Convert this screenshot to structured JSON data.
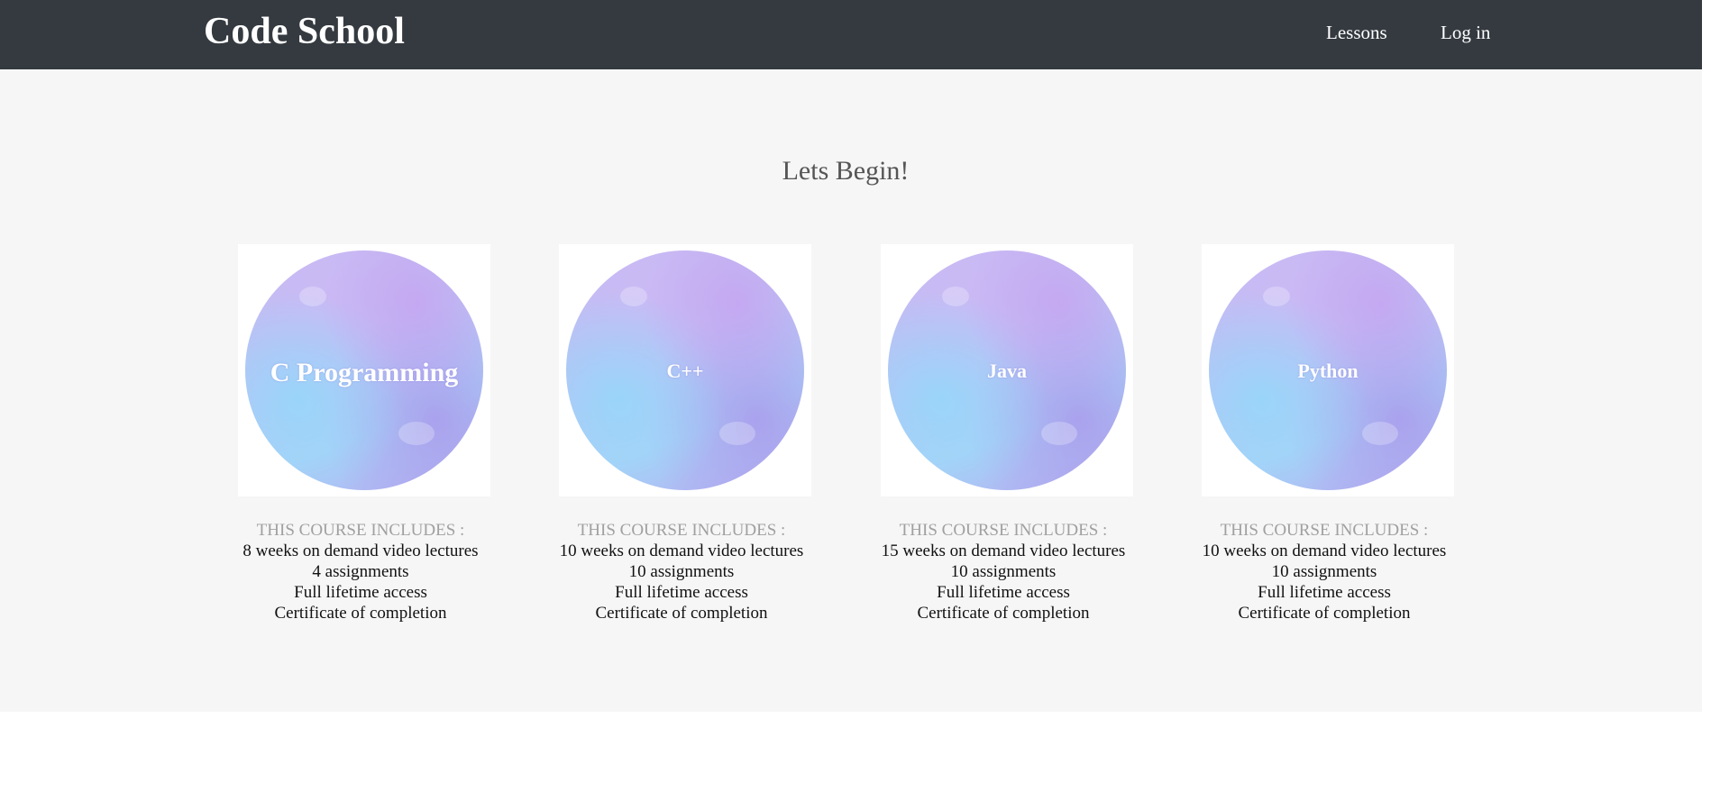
{
  "navbar": {
    "brand": "Code School",
    "links": [
      {
        "label": "Lessons"
      },
      {
        "label": "Log in"
      }
    ]
  },
  "main": {
    "title": "Lets Begin!",
    "courses": [
      {
        "name": "C Programming",
        "includes_label": "THIS COURSE INCLUDES :",
        "features": [
          "8 weeks on demand video lectures",
          "4 assignments",
          "Full lifetime access",
          "Certificate of completion"
        ]
      },
      {
        "name": "C++",
        "includes_label": "THIS COURSE INCLUDES :",
        "features": [
          "10 weeks on demand video lectures",
          "10 assignments",
          "Full lifetime access",
          "Certificate of completion"
        ]
      },
      {
        "name": "Java",
        "includes_label": "THIS COURSE INCLUDES :",
        "features": [
          "15 weeks on demand video lectures",
          "10 assignments",
          "Full lifetime access",
          "Certificate of completion"
        ]
      },
      {
        "name": "Python",
        "includes_label": "THIS COURSE INCLUDES :",
        "features": [
          "10 weeks on demand video lectures",
          "10 assignments",
          "Full lifetime access",
          "Certificate of completion"
        ]
      }
    ]
  },
  "colors": {
    "navbar_bg": "#343a40",
    "page_bg": "#f6f6f6",
    "title_text": "#555555",
    "includes_label": "#a0a0a0",
    "card_title_text": "#ffffff"
  },
  "icons": [
    "watercolor-circle-image"
  ]
}
